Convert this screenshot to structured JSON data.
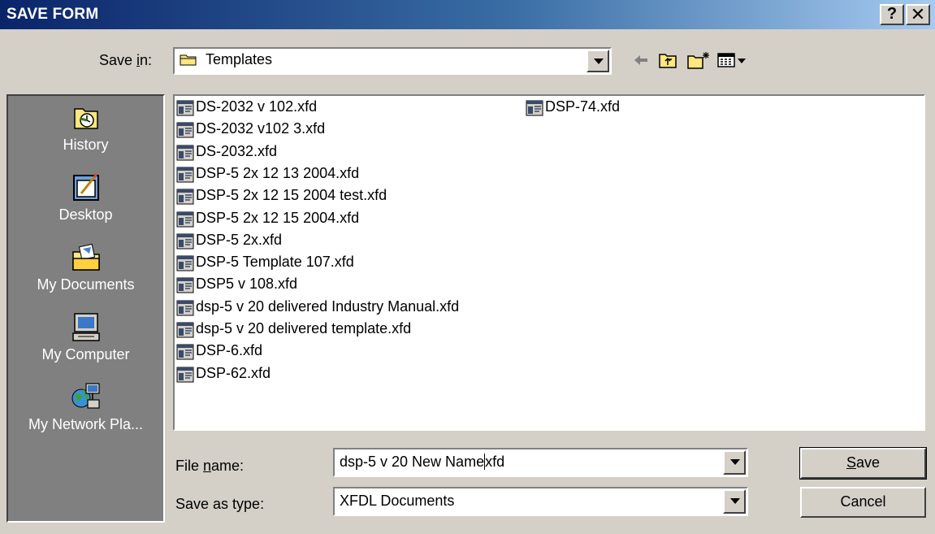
{
  "window": {
    "title": "SAVE FORM",
    "help_label": "?",
    "close_label": "✕"
  },
  "save_in": {
    "label_pre": "Save ",
    "label_key": "i",
    "label_post": "n:",
    "value": "Templates"
  },
  "toolbar": [
    "back-arrow-icon",
    "up-one-level-icon",
    "new-folder-icon",
    "view-menu-icon"
  ],
  "places": [
    {
      "label": "History",
      "icon": "history-icon"
    },
    {
      "label": "Desktop",
      "icon": "desktop-icon"
    },
    {
      "label": "My Documents",
      "icon": "my-documents-icon"
    },
    {
      "label": "My Computer",
      "icon": "my-computer-icon"
    },
    {
      "label": "My Network Pla...",
      "icon": "my-network-places-icon"
    }
  ],
  "files_col1": [
    "DS-2032 v 102.xfd",
    "DS-2032 v102 3.xfd",
    "DS-2032.xfd",
    "DSP-5 2x 12 13 2004.xfd",
    "DSP-5 2x 12 15 2004 test.xfd",
    "DSP-5 2x 12 15 2004.xfd",
    "DSP-5 2x.xfd",
    "DSP-5 Template 107.xfd",
    "DSP5 v 108.xfd",
    "dsp-5 v 20 delivered Industry Manual.xfd",
    "dsp-5 v 20 delivered template.xfd",
    "DSP-6.xfd",
    "DSP-62.xfd"
  ],
  "files_col2": [
    "DSP-74.xfd"
  ],
  "file_name": {
    "label_pre": "File ",
    "label_key": "n",
    "label_post": "ame:",
    "value_before_caret": "dsp-5 v 20 New Name",
    "value_after_caret": "xfd"
  },
  "save_as_type": {
    "label": "Save as type:",
    "value": "XFDL Documents"
  },
  "buttons": {
    "save_key": "S",
    "save_rest": "ave",
    "cancel": "Cancel"
  }
}
